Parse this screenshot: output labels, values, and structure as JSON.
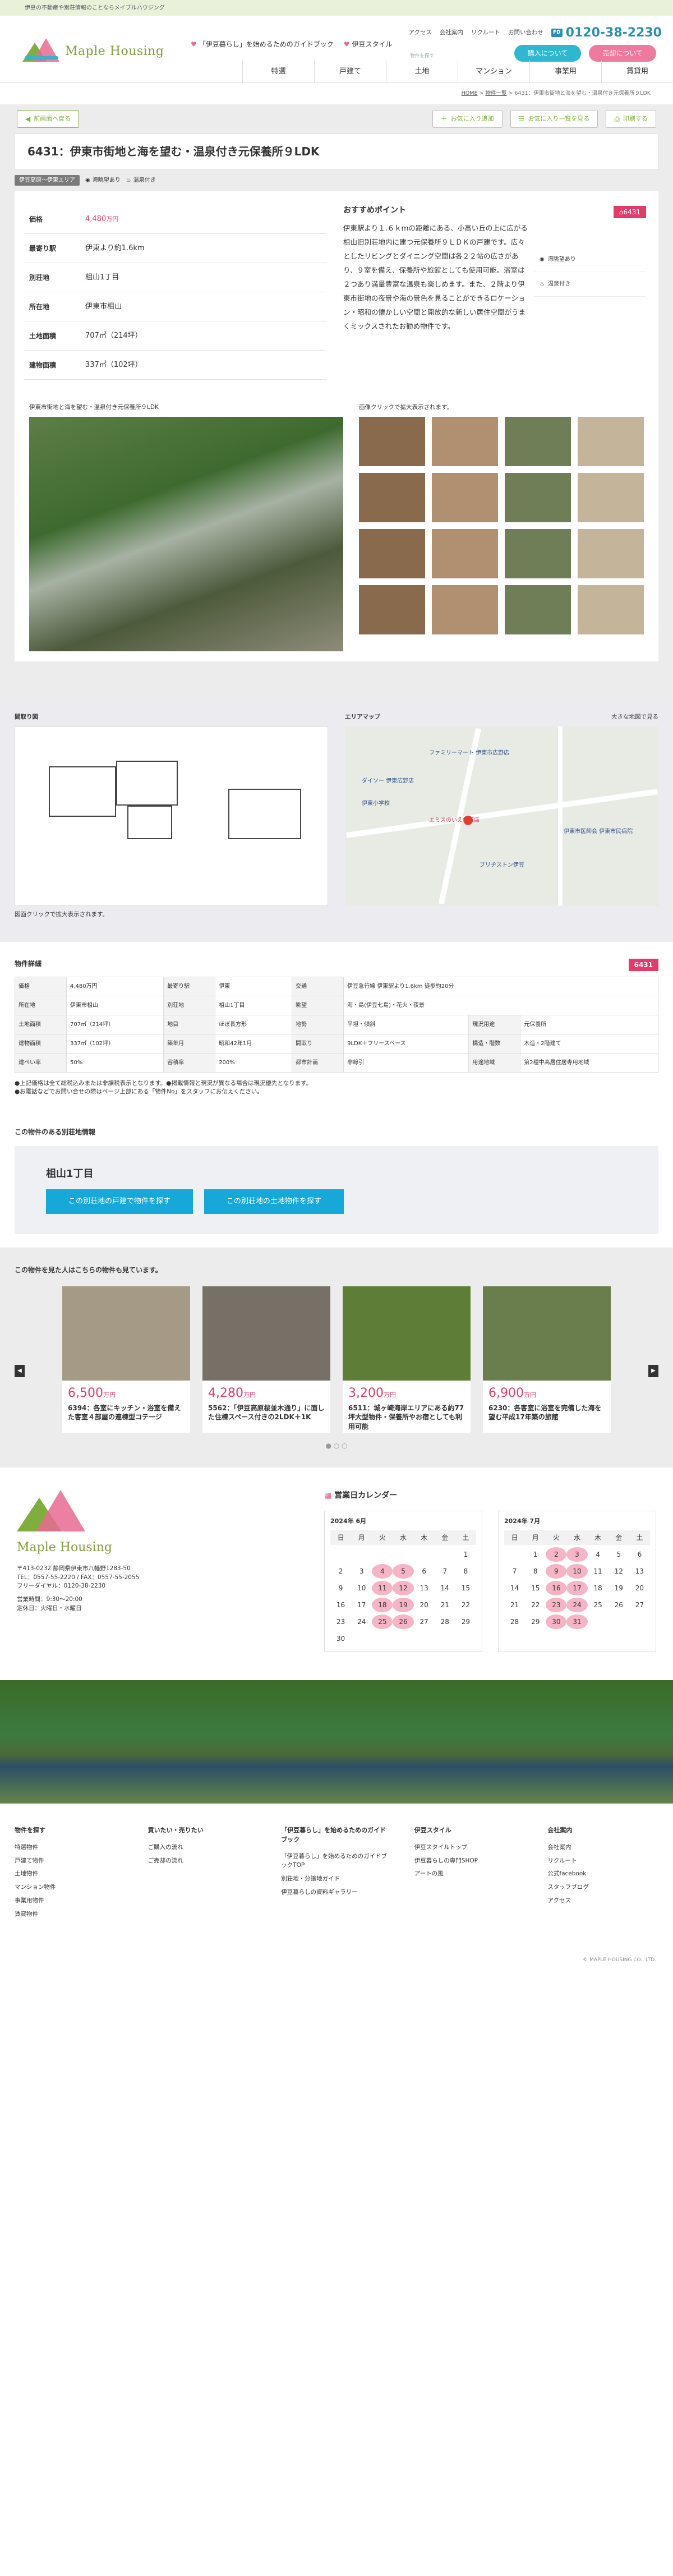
{
  "topbar": {
    "text": "伊豆の不動産や別荘情報のことならメイプルハウジング"
  },
  "header": {
    "logo": "Maple Housing",
    "nav": [
      "「伊豆暮らし」を始めるためのガイドブック",
      "伊豆スタイル"
    ],
    "links": [
      "アクセス",
      "会社案内",
      "リクルート",
      "お問い合わせ"
    ],
    "phone_label": "FD",
    "phone": "0120-38-2230",
    "buy_label": "購入について",
    "sell_label": "売却について",
    "cat_caption": "物件を探す",
    "cats": [
      "特選",
      "戸建て",
      "土地",
      "マンション",
      "事業用",
      "賃貸用"
    ]
  },
  "breadcrumb": {
    "home": "HOME",
    "list": "物件一覧",
    "current": "6431：伊東市街地と海を望む・温泉付き元保養所９LDK"
  },
  "actions": {
    "back": "前画面へ戻る",
    "fav_add": "お気に入り追加",
    "fav_view": "お気に入り一覧を見る",
    "print": "印刷する"
  },
  "property": {
    "title": "6431：伊東市街地と海を望む・温泉付き元保養所９LDK",
    "badge": "伊豆高原〜伊東エリア",
    "tags": [
      "海眺望あり",
      "温泉付き"
    ],
    "id": "6431",
    "summary": [
      {
        "k": "価格",
        "v": "4,480",
        "unit": "万円"
      },
      {
        "k": "最寄り駅",
        "v": "伊東より約1.6km"
      },
      {
        "k": "別荘地",
        "v": "柤山1丁目"
      },
      {
        "k": "所在地",
        "v": "伊東市柤山"
      },
      {
        "k": "土地面積",
        "v": "707㎡（214坪）"
      },
      {
        "k": "建物面積",
        "v": "337㎡（102坪）"
      }
    ],
    "point_title": "おすすめポイント",
    "point": "伊東駅より１.６ｋｍの距離にある、小高い丘の上に広がる柤山旧別荘地内に建つ元保養所９ＬＤＫの戸建です。広々としたリビングとダイニング空間は各２２帖の広さがあり、９室を備え、保養所や旅館としても使用可能。浴室は２つあり満量豊富な温泉も楽しめます。また、２階より伊東市街地の夜景や海の景色を見ることができるロケーション・昭和の懐かしい空間と開放的な新しい居住空間がうまくミックスされたお勧め物件です。",
    "main_caption": "伊東市街地と海を望む・温泉付き元保養所９LDK",
    "thumb_caption": "画像クリックで拡大表示されます。"
  },
  "plan": {
    "title": "間取り図",
    "note": "図面クリックで拡大表示されます。"
  },
  "map": {
    "title": "エリアマップ",
    "link": "大きな地図で見る",
    "labels": [
      "ファミリーマート 伊東市広野店",
      "ダイソー 伊東広野店",
      "伊東小学校",
      "エミスのいえ伊東店",
      "ブリヂストン伊豆",
      "伊東市医師会 伊東市民病院"
    ]
  },
  "detail": {
    "title": "物件詳細",
    "id": "6431",
    "rows": [
      [
        "価格",
        "4,480万円",
        "最寄り駅",
        "伊東",
        "交通",
        "伊豆急行線 伊東駅より1.6km 徒歩約20分"
      ],
      [
        "所在地",
        "伊東市柤山",
        "別荘地",
        "柤山1丁目",
        "眺望",
        "海・島(伊豆七島)・花火・夜景"
      ],
      [
        "土地面積",
        "707㎡（214坪）",
        "地目",
        "ほぼ長方形",
        "地勢",
        "平坦・傾斜",
        "現況用途",
        "元保養所"
      ],
      [
        "建物面積",
        "337㎡（102坪）",
        "築年月",
        "昭和42年1月",
        "間取り",
        "9LDK＋フリースペース",
        "構造・階数",
        "木造・2階建て"
      ],
      [
        "建ぺい率",
        "50%",
        "容積率",
        "200%",
        "都市計画",
        "非線引",
        "用途地域",
        "第2種中高層住居専用地域"
      ]
    ],
    "notes": [
      "●上記価格は全て総税込みまたは非課税表示となります。●掲載情報と現況が異なる場合は現況優先となります。",
      "●お電話などでお問い合せの際はページ上部にある「物件No」をスタッフにお伝えください。"
    ]
  },
  "area": {
    "title": "この物件のある別荘地情報",
    "name": "柤山1丁目",
    "btn1": "この別荘地の戸建で物件を探す",
    "btn2": "この別荘地の土地物件を探す"
  },
  "recommend": {
    "title": "この物件を見た人はこちらの物件も見ています。",
    "cards": [
      {
        "price": "6,500",
        "name": "6394：各室にキッチン・浴室を備えた客室４部屋の連棟型コテージ"
      },
      {
        "price": "4,280",
        "name": "5562：「伊豆高原桜並木通り」に面した住棟スペース付きの2LDK＋1K"
      },
      {
        "price": "3,200",
        "name": "6511：城ヶ崎海岸エリアにある約77坪大型物件・保養所やお宿としても利用可能"
      },
      {
        "price": "6,900",
        "name": "6230：各客室に浴室を完備した海を望む平成17年築の旅館"
      }
    ],
    "unit": "万円"
  },
  "footer": {
    "logo": "Maple Housing",
    "addr": "〒413-0232 静岡県伊東市八幡野1283-50",
    "tel": "TEL：0557-55-2220 / FAX：0557-55-2055",
    "free": "フリーダイヤル：0120-38-2230",
    "hours": "営業時間：9:30〜20:00",
    "closed": "定休日：火曜日・水曜日",
    "calendar_title": "営業日カレンダー",
    "months": [
      "2024年 6月",
      "2024年 7月"
    ],
    "week": [
      "日",
      "月",
      "火",
      "水",
      "木",
      "金",
      "土"
    ]
  },
  "links": {
    "cols": [
      {
        "h": "物件を探す",
        "items": [
          "特選物件",
          "戸建て物件",
          "土地物件",
          "マンション物件",
          "事業用物件",
          "賃貸物件"
        ]
      },
      {
        "h": "買いたい・売りたい",
        "items": [
          "ご購入の流れ",
          "ご売却の流れ"
        ]
      },
      {
        "h": "「伊豆暮らし」を始めるためのガイドブック",
        "items": [
          "「伊豆暮らし」を始めるためのガイドブックTOP",
          "別荘地・分譲地ガイド",
          "伊豆暮らしの資料ギャラリー"
        ]
      },
      {
        "h": "伊豆スタイル",
        "items": [
          "伊豆スタイルトップ",
          "伊豆暮らしの専門SHOP",
          "アートの風"
        ]
      },
      {
        "h": "会社案内",
        "items": [
          "会社案内",
          "リクルート",
          "公式facebook",
          "スタッフブログ",
          "アクセス"
        ]
      }
    ],
    "copy": "© MAPLE HOUSING CO., LTD."
  }
}
